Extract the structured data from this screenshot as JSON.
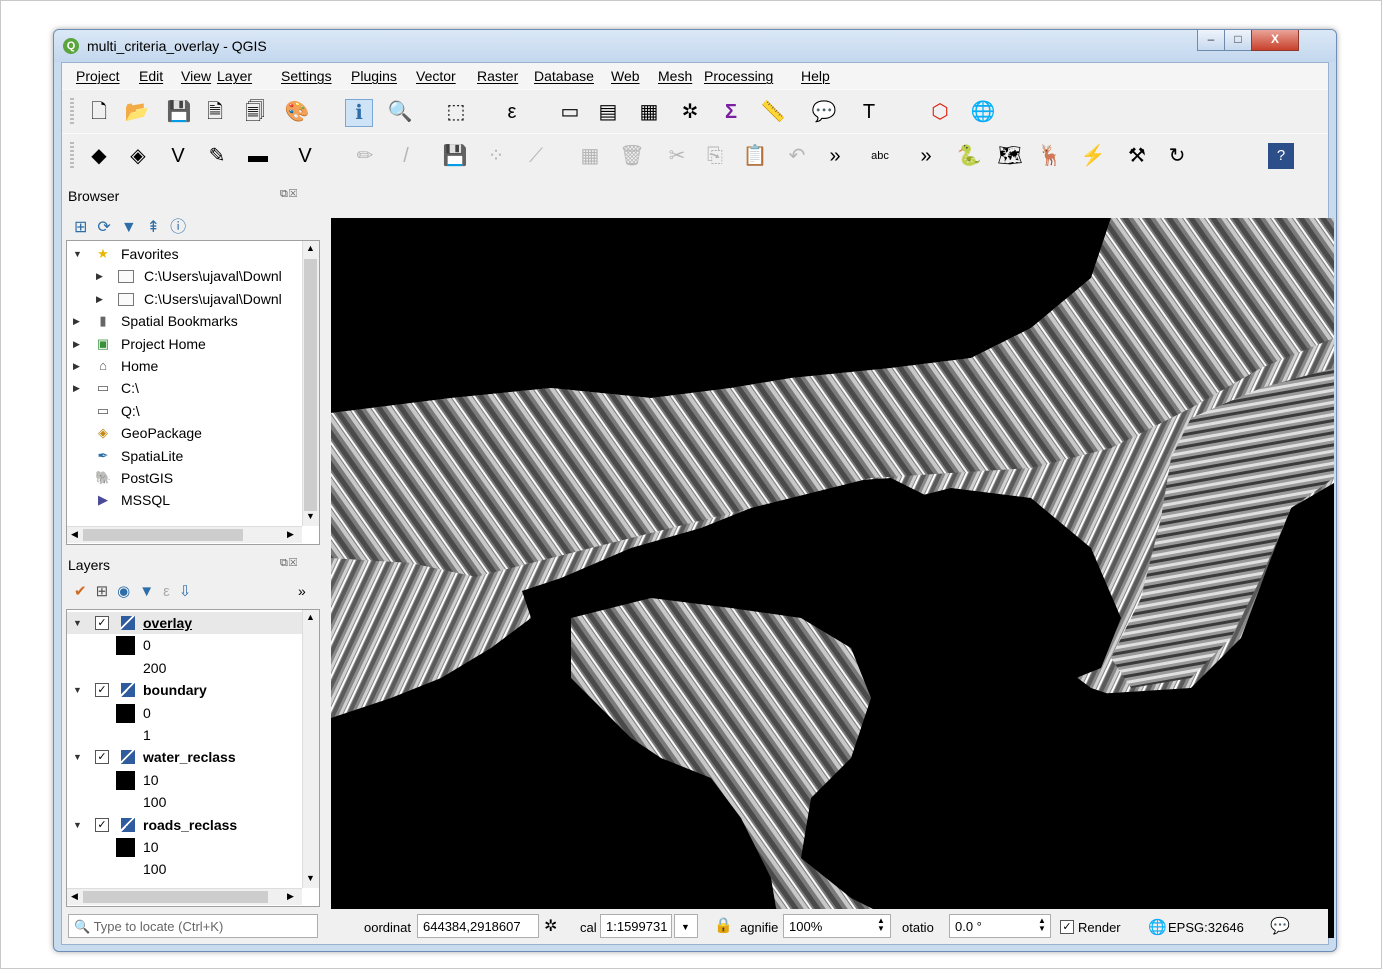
{
  "window": {
    "title": "multi_criteria_overlay - QGIS",
    "minimize": "–",
    "maximize": "□",
    "close": "X"
  },
  "menu": [
    "Project",
    "Edit",
    "View",
    "Layer",
    "Settings",
    "Plugins",
    "Vector",
    "Raster",
    "Database",
    "Web",
    "Mesh",
    "Processing",
    "Help"
  ],
  "toolbar1": [
    {
      "name": "new-project-icon",
      "glyph": "🗋"
    },
    {
      "name": "open-project-icon",
      "glyph": "📂"
    },
    {
      "name": "save-project-icon",
      "glyph": "💾"
    },
    {
      "name": "new-print-layout-icon",
      "glyph": "🗎"
    },
    {
      "name": "layout-manager-icon",
      "glyph": "🗐"
    },
    {
      "name": "style-manager-icon",
      "glyph": "🎨"
    },
    {
      "name": "identify-features-icon",
      "glyph": "ℹ"
    },
    {
      "name": "zoom-icon",
      "glyph": "🔍"
    },
    {
      "name": "select-features-icon",
      "glyph": "⬚"
    },
    {
      "name": "select-by-value-icon",
      "glyph": "ε"
    },
    {
      "name": "deselect-icon",
      "glyph": "▭"
    },
    {
      "name": "attribute-table-icon",
      "glyph": "▤"
    },
    {
      "name": "field-calculator-icon",
      "glyph": "▦"
    },
    {
      "name": "toolbox-icon",
      "glyph": "✲"
    },
    {
      "name": "statistics-icon",
      "glyph": "Σ"
    },
    {
      "name": "measure-icon",
      "glyph": "📏"
    },
    {
      "name": "map-tips-icon",
      "glyph": "💬"
    },
    {
      "name": "text-annotation-icon",
      "glyph": "T"
    },
    {
      "name": "hexagon-icon",
      "glyph": "⬡"
    },
    {
      "name": "globe-icon",
      "glyph": "🌐"
    }
  ],
  "toolbar2": [
    {
      "name": "data-source-manager-icon",
      "glyph": "◆"
    },
    {
      "name": "new-geopackage-icon",
      "glyph": "◈"
    },
    {
      "name": "new-shapefile-icon",
      "glyph": "V"
    },
    {
      "name": "new-spatialite-icon",
      "glyph": "✎"
    },
    {
      "name": "new-memory-layer-icon",
      "glyph": "▬"
    },
    {
      "name": "virtual-layer-icon",
      "glyph": "V"
    },
    {
      "name": "edit-pencil-icon",
      "glyph": "✏"
    },
    {
      "name": "toggle-editing-icon",
      "glyph": "/"
    },
    {
      "name": "save-edits-icon",
      "glyph": "💾"
    },
    {
      "name": "add-point-icon",
      "glyph": "⁘"
    },
    {
      "name": "vertex-tool-icon",
      "glyph": "⟋"
    },
    {
      "name": "modify-attributes-icon",
      "glyph": "▦"
    },
    {
      "name": "delete-selected-icon",
      "glyph": "🗑"
    },
    {
      "name": "cut-icon",
      "glyph": "✂"
    },
    {
      "name": "copy-icon",
      "glyph": "⎘"
    },
    {
      "name": "paste-icon",
      "glyph": "📋"
    },
    {
      "name": "undo-icon",
      "glyph": "↶"
    },
    {
      "name": "overflow-icon",
      "glyph": "»"
    },
    {
      "name": "label-icon",
      "glyph": "abc"
    },
    {
      "name": "overflow-icon-2",
      "glyph": "»"
    },
    {
      "name": "python-console-icon",
      "glyph": "🐍"
    },
    {
      "name": "map-plugin-icon",
      "glyph": "🗺"
    },
    {
      "name": "deer-plugin-icon",
      "glyph": "🦌"
    },
    {
      "name": "digitize-plugin-icon",
      "glyph": "⚡"
    },
    {
      "name": "tools-plugin-icon",
      "glyph": "⚒"
    },
    {
      "name": "refresh-plugin-icon",
      "glyph": "↻"
    },
    {
      "name": "help-icon",
      "glyph": "?"
    }
  ],
  "browser": {
    "title": "Browser",
    "items": [
      {
        "label": "Favorites",
        "icon": "star-icon",
        "expanded": true,
        "indent": 0
      },
      {
        "label": "C:\\Users\\ujaval\\Downl",
        "icon": "folder-icon",
        "indent": 1
      },
      {
        "label": "C:\\Users\\ujaval\\Downl",
        "icon": "folder-icon",
        "indent": 1
      },
      {
        "label": "Spatial Bookmarks",
        "icon": "bookmark-icon",
        "indent": 0
      },
      {
        "label": "Project Home",
        "icon": "project-home-icon",
        "indent": 0
      },
      {
        "label": "Home",
        "icon": "home-icon",
        "indent": 0
      },
      {
        "label": "C:\\",
        "icon": "drive-icon",
        "indent": 0
      },
      {
        "label": "Q:\\",
        "icon": "drive-icon",
        "indent": 0
      },
      {
        "label": "GeoPackage",
        "icon": "geopackage-icon",
        "indent": 0
      },
      {
        "label": "SpatiaLite",
        "icon": "spatialite-icon",
        "indent": 0
      },
      {
        "label": "PostGIS",
        "icon": "postgis-icon",
        "indent": 0
      },
      {
        "label": "MSSQL",
        "icon": "mssql-icon",
        "indent": 0
      }
    ]
  },
  "layers": {
    "title": "Layers",
    "items": [
      {
        "name": "overlay",
        "values": [
          "0",
          "200"
        ],
        "selected": true
      },
      {
        "name": "boundary",
        "values": [
          "0",
          "1"
        ]
      },
      {
        "name": "water_reclass",
        "values": [
          "10",
          "100"
        ]
      },
      {
        "name": "roads_reclass",
        "values": [
          "10",
          "100"
        ]
      }
    ]
  },
  "status": {
    "locator_placeholder": "Type to locate (Ctrl+K)",
    "coordinate_label": "oordinat",
    "coordinate_value": "644384,2918607",
    "scale_label": "cal",
    "scale_value": "1:1599731",
    "magnifier_label": "agnifie",
    "magnifier_value": "100%",
    "rotation_label": "otatio",
    "rotation_value": "0.0 °",
    "render_label": "Render",
    "crs": "EPSG:32646"
  }
}
